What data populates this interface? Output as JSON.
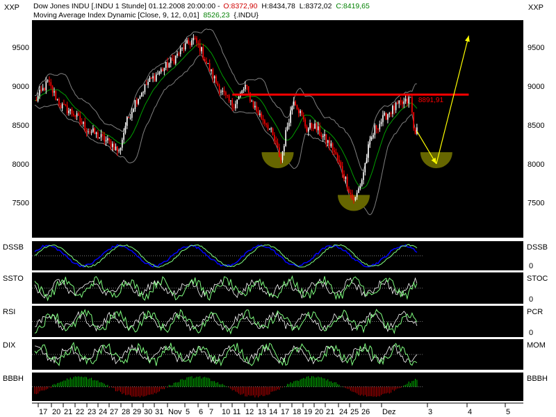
{
  "header": {
    "symbol_line": "Dow Jones INDU [.INDU  1 Stunde] 01.12.2008 20:00:00 -",
    "open": "O:8372,90",
    "high": "H:8434,78",
    "low": "L:8372,02",
    "close": "C:8419,65",
    "indicator_line": "Moving Average Index Dynamic [Close, 9, 12, 0,01]",
    "indicator_value": "8526,23",
    "indicator_symbol": "{.INDU}",
    "left_scale_label": "XXP",
    "right_scale_label": "XXP"
  },
  "colors": {
    "background": "#000000",
    "up_candle": "#ffffff",
    "down_candle": "#ff0000",
    "ma_line": "#00a000",
    "band_line": "#808080",
    "resistance": "#ff0000",
    "arrow": "#ffff00",
    "half_circle": "#666600",
    "dssb_main": "#0000ff",
    "oscillator_main": "#80ff80",
    "histogram_up": "#00c000",
    "histogram_down": "#c00000"
  },
  "chart_data": {
    "type": "candlestick",
    "ylim": [
      7050,
      9850
    ],
    "y_ticks": [
      9500,
      9000,
      8500,
      8000,
      7500
    ],
    "y_tick_labels": [
      "9500",
      "9000",
      "8500",
      "8000",
      "7500"
    ],
    "resistance_level": 8891.91,
    "resistance_label": "8891,91",
    "x_tick_labels": [
      "17",
      "20",
      "21",
      "22",
      "23",
      "24",
      "27",
      "28",
      "29",
      "30",
      "31",
      "Nov",
      "5",
      "6",
      "7",
      "10",
      "11",
      "12",
      "13",
      "14",
      "17",
      "18",
      "19",
      "20",
      "21",
      "24",
      "25",
      "26",
      "Dez",
      "3",
      "4",
      "5"
    ],
    "price_path_hourly_close": [
      [
        0,
        8800
      ],
      [
        8,
        9050
      ],
      [
        16,
        8750
      ],
      [
        24,
        8650
      ],
      [
        32,
        8450
      ],
      [
        40,
        8350
      ],
      [
        48,
        8250
      ],
      [
        52,
        8150
      ],
      [
        56,
        8500
      ],
      [
        62,
        8800
      ],
      [
        70,
        9050
      ],
      [
        78,
        9200
      ],
      [
        86,
        9350
      ],
      [
        92,
        9500
      ],
      [
        98,
        9600
      ],
      [
        102,
        9500
      ],
      [
        106,
        9300
      ],
      [
        112,
        9050
      ],
      [
        118,
        8850
      ],
      [
        122,
        8750
      ],
      [
        126,
        8850
      ],
      [
        130,
        9000
      ],
      [
        134,
        8800
      ],
      [
        138,
        8650
      ],
      [
        144,
        8500
      ],
      [
        148,
        8300
      ],
      [
        152,
        8050
      ],
      [
        156,
        8500
      ],
      [
        160,
        8850
      ],
      [
        164,
        8650
      ],
      [
        168,
        8450
      ],
      [
        172,
        8500
      ],
      [
        176,
        8400
      ],
      [
        180,
        8300
      ],
      [
        184,
        8200
      ],
      [
        188,
        8000
      ],
      [
        192,
        7800
      ],
      [
        196,
        7550
      ],
      [
        198,
        7550
      ],
      [
        202,
        7800
      ],
      [
        206,
        8200
      ],
      [
        210,
        8450
      ],
      [
        214,
        8550
      ],
      [
        218,
        8650
      ],
      [
        224,
        8750
      ],
      [
        230,
        8800
      ],
      [
        232,
        8850
      ],
      [
        234,
        8450
      ],
      [
        236,
        8420
      ]
    ],
    "annotations": {
      "bottom_markers": [
        {
          "x": 150,
          "price": 8150
        },
        {
          "x": 197,
          "price": 7600
        },
        {
          "x": 248,
          "price": 8150
        }
      ],
      "arrows": [
        {
          "from": [
            236,
            8420
          ],
          "to": [
            248,
            8000
          ]
        },
        {
          "from": [
            248,
            8000
          ],
          "to": [
            268,
            9650
          ]
        }
      ]
    },
    "indicators": [
      {
        "name": "DSSB",
        "right_label": "DSSB",
        "ticks": [
          "0"
        ]
      },
      {
        "name": "SSTO",
        "right_label": "STOC",
        "ticks": [
          "0"
        ]
      },
      {
        "name": "RSI",
        "right_label": "PCR",
        "ticks": [
          "0"
        ]
      },
      {
        "name": "DIX",
        "right_label": "MOM",
        "ticks": []
      },
      {
        "name": "BBBH",
        "right_label": "BBBH",
        "ticks": []
      }
    ]
  }
}
